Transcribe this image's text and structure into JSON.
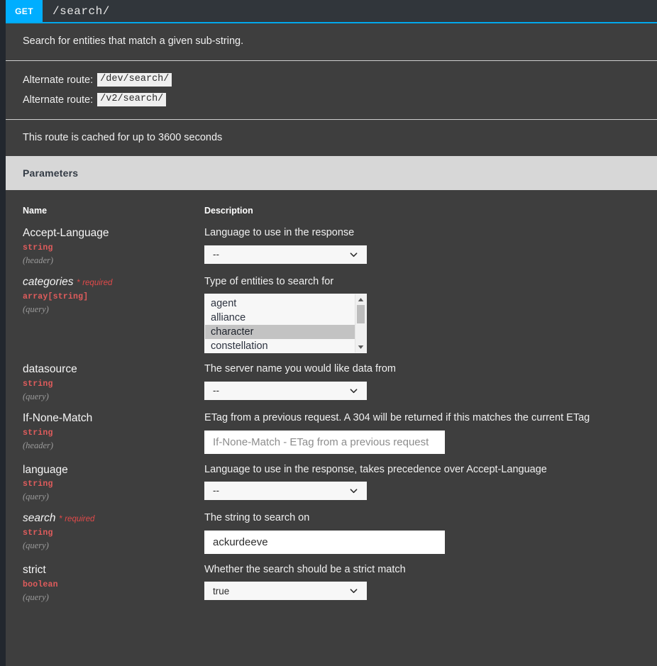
{
  "header": {
    "method": "GET",
    "path": "/search/",
    "accent_color": "#00aeff"
  },
  "summary": "Search for entities that match a given sub-string.",
  "alternate_routes": [
    {
      "label": "Alternate route:",
      "route": "/dev/search/"
    },
    {
      "label": "Alternate route:",
      "route": "/v2/search/"
    }
  ],
  "cache_note": "This route is cached for up to 3600 seconds",
  "parameters_section": {
    "title": "Parameters",
    "columns": {
      "name": "Name",
      "description": "Description"
    },
    "rows": [
      {
        "name": "Accept-Language",
        "required": false,
        "required_label": "",
        "type": "string",
        "location": "(header)",
        "description": "Language to use in the response",
        "control": "select",
        "value": "--"
      },
      {
        "name": "categories",
        "required": true,
        "required_label": "required",
        "required_star": "*",
        "type": "array[string]",
        "location": "(query)",
        "description": "Type of entities to search for",
        "control": "listbox",
        "options": [
          "agent",
          "alliance",
          "character",
          "constellation"
        ],
        "selected": "character"
      },
      {
        "name": "datasource",
        "required": false,
        "required_label": "",
        "type": "string",
        "location": "(query)",
        "description": "The server name you would like data from",
        "control": "select",
        "value": "--"
      },
      {
        "name": "If-None-Match",
        "required": false,
        "required_label": "",
        "type": "string",
        "location": "(header)",
        "description": "ETag from a previous request. A 304 will be returned if this matches the current ETag",
        "control": "text",
        "value": "",
        "placeholder": "If-None-Match - ETag from a previous request"
      },
      {
        "name": "language",
        "required": false,
        "required_label": "",
        "type": "string",
        "location": "(query)",
        "description": "Language to use in the response, takes precedence over Accept-Language",
        "control": "select",
        "value": "--"
      },
      {
        "name": "search",
        "required": true,
        "required_label": "required",
        "required_star": "*",
        "type": "string",
        "location": "(query)",
        "description": "The string to search on",
        "control": "text",
        "value": "ackurdeeve",
        "placeholder": ""
      },
      {
        "name": "strict",
        "required": false,
        "required_label": "",
        "type": "boolean",
        "location": "(query)",
        "description": "Whether the search should be a strict match",
        "control": "select",
        "value": "true"
      }
    ]
  }
}
